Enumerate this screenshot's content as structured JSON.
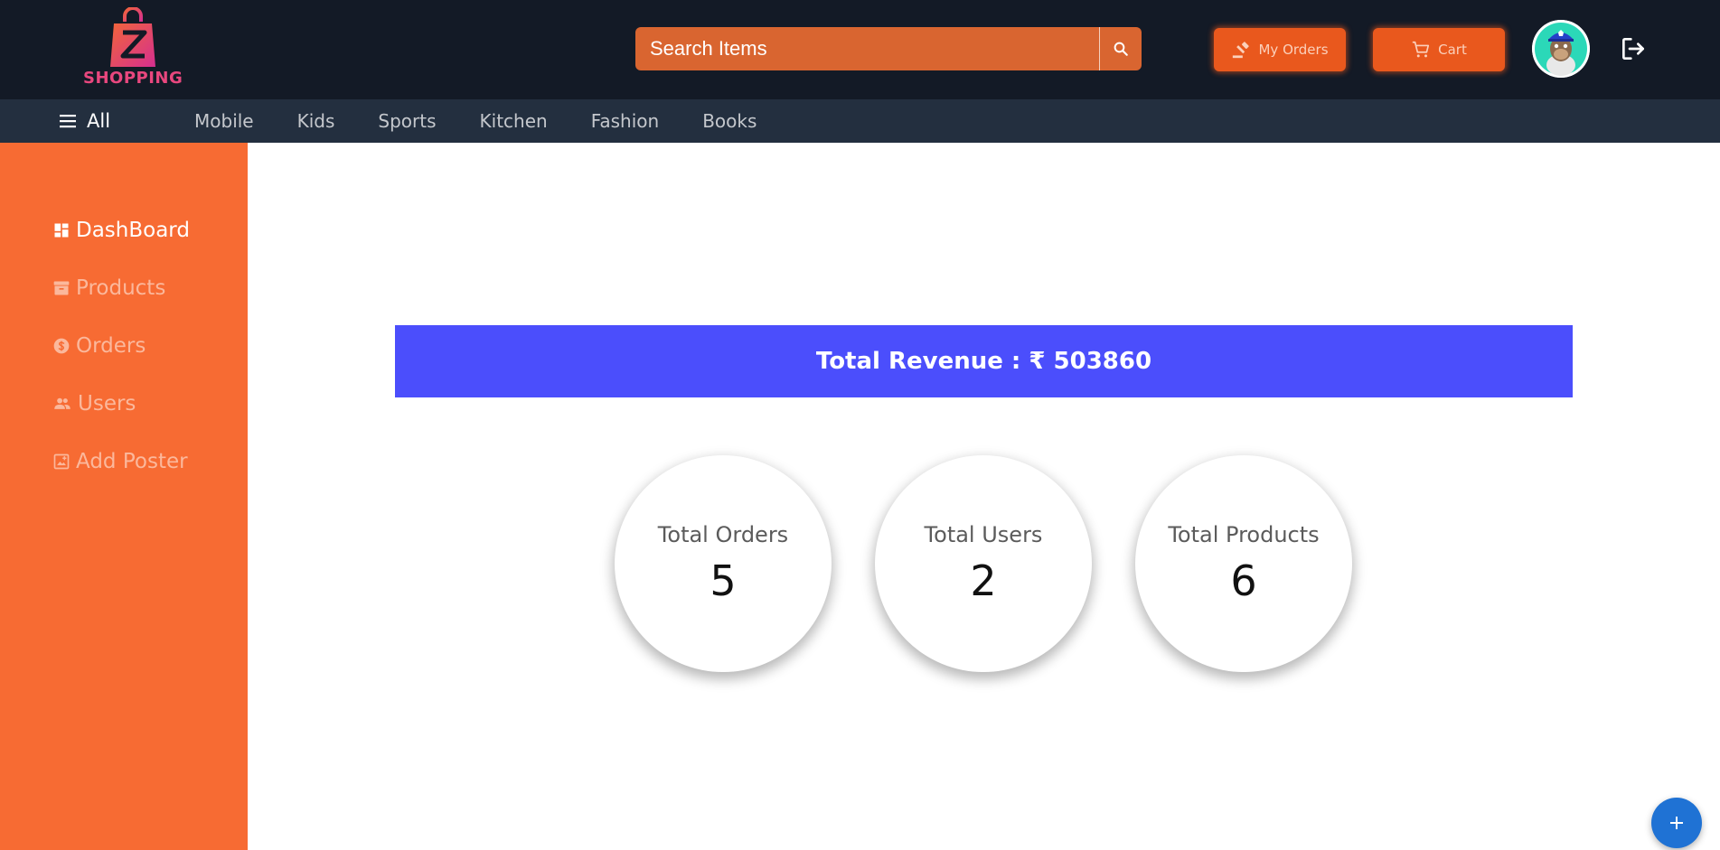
{
  "header": {
    "logo_text": "SHOPPING",
    "search_placeholder": "Search Items",
    "my_orders_label": "My Orders",
    "cart_label": "Cart"
  },
  "categories": {
    "all_label": "All",
    "items": [
      "Mobile",
      "Kids",
      "Sports",
      "Kitchen",
      "Fashion",
      "Books"
    ]
  },
  "sidebar": {
    "items": [
      {
        "label": "DashBoard",
        "icon": "dashboard-icon",
        "active": true
      },
      {
        "label": "Products",
        "icon": "inventory-icon",
        "active": false
      },
      {
        "label": "Orders",
        "icon": "dollar-icon",
        "active": false
      },
      {
        "label": "Users",
        "icon": "users-icon",
        "active": false
      },
      {
        "label": "Add Poster",
        "icon": "add-poster-icon",
        "active": false
      }
    ]
  },
  "main": {
    "revenue_text": "Total Revenue : ₹ 503860",
    "stats": [
      {
        "label": "Total Orders",
        "value": "5"
      },
      {
        "label": "Total Users",
        "value": "2"
      },
      {
        "label": "Total Products",
        "value": "6"
      }
    ]
  },
  "colors": {
    "header_bg": "#131a26",
    "category_bar_bg": "#232f3f",
    "sidebar_bg": "#f76b33",
    "accent_orange": "#e9581d",
    "revenue_banner": "#4b4efc",
    "fab_blue": "#1f72d4"
  }
}
